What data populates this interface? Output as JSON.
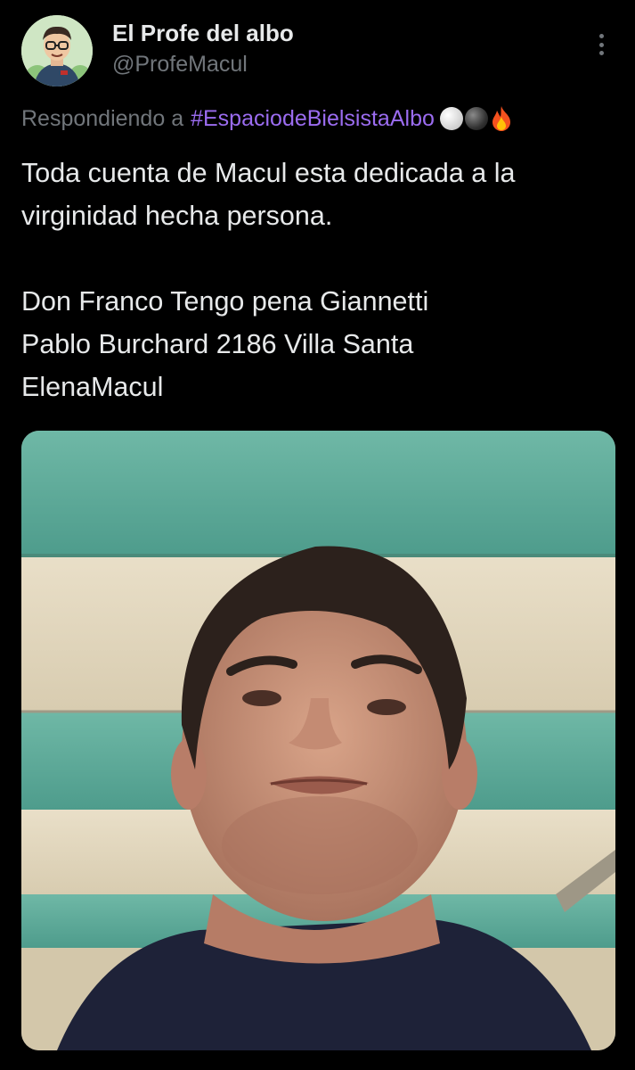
{
  "author": {
    "display_name": "El Profe del albo",
    "handle": "@ProfeMacul",
    "avatar_icon": "cartoon-teacher-avatar"
  },
  "replying": {
    "prefix": "Respondiendo a",
    "hashtag": "#EspaciodeBielsistaAlbo",
    "emoji_icons": [
      "white-circle-icon",
      "black-circle-icon",
      "fire-icon"
    ]
  },
  "tweet": {
    "paragraph1": "Toda cuenta de Macul esta dedicada a la virginidad hecha persona.",
    "line2": "Don Franco Tengo pena Giannetti",
    "line3": "Pablo Burchard 2186 Villa Santa",
    "line4": "ElenaMacul"
  },
  "media": {
    "kind": "photo",
    "description_icon": "selfie-photo"
  },
  "colors": {
    "background": "#000000",
    "primary_text": "#e7e9ea",
    "secondary_text": "#71767b",
    "hashtag": "#9b6cf0"
  }
}
